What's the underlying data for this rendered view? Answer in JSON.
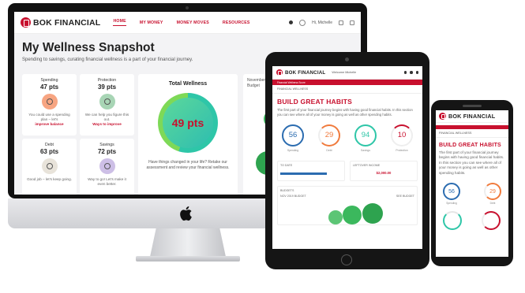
{
  "desktop": {
    "brand": "BOK FINANCIAL",
    "nav": [
      "HOME",
      "MY MONEY",
      "MONEY MOVES",
      "RESOURCES"
    ],
    "user": "Hi, Michelle",
    "title": "My Wellness Snapshot",
    "subtitle": "Spending to savings, curating financial wellness is a part of your financial journey.",
    "tiles": [
      {
        "name": "Spending",
        "pts": "47 pts",
        "text": "You could use a spending plan – let's",
        "link": "improve balance",
        "color": "#f7a582"
      },
      {
        "name": "Protection",
        "pts": "39 pts",
        "text": "We can help you figure this out.",
        "link": "Ways to improve",
        "color": "#a8d5b5"
      },
      {
        "name": "Debt",
        "pts": "63 pts",
        "text": "Good job – let's keep going.",
        "link": "",
        "color": "#e8e3da"
      },
      {
        "name": "Savings",
        "pts": "72 pts",
        "text": "Way to go! Let's make it even better.",
        "link": "",
        "color": "#cdbfe6"
      }
    ],
    "total": {
      "title": "Total Wellness",
      "score": "49 pts",
      "text": "Have things changed in your life? Retake our assessment and review your financial wellness."
    },
    "side_card": {
      "line1": "November",
      "line2": "Budget"
    }
  },
  "tablet": {
    "brand": "BOK FINANCIAL",
    "welcome": "Welcome Michelle",
    "bar_text": "Financial Wellness Score",
    "section": "FINANCIAL WELLNESS",
    "heading": "BUILD GREAT HABITS",
    "para": "The first part of your financial journey begins with having good financial habits. In this section you can see where all of your money is going as well as other spending habits.",
    "scores": [
      {
        "value": "56",
        "color": "#2b6cb0",
        "caption": "Spending"
      },
      {
        "value": "29",
        "color": "#f07a3c",
        "caption": "Debt"
      },
      {
        "value": "94",
        "color": "#2ec6a8",
        "caption": "Savings"
      },
      {
        "value": "10",
        "color": "#c8102e",
        "caption": "Protection"
      }
    ],
    "box1": "TO DATE",
    "box2": "LEFTOVER INCOME",
    "box2_value": "$2,000.00",
    "budget_title": "BUDGETS",
    "budget_left": "NOV 2019 BUDGET",
    "budget_right": "SEE BUDGET"
  },
  "phone": {
    "brand": "BOK FINANCIAL",
    "section": "FINANCIAL WELLNESS",
    "heading": "BUILD GREAT HABITS",
    "para": "The first part of your financial journey begins with having good financial habits. In this section you can see where all of your money is going as well as other spending habits.",
    "scores": [
      {
        "value": "56",
        "color": "#2b6cb0",
        "caption": "Spending"
      },
      {
        "value": "29",
        "color": "#f07a3c",
        "caption": "Debt"
      }
    ]
  }
}
